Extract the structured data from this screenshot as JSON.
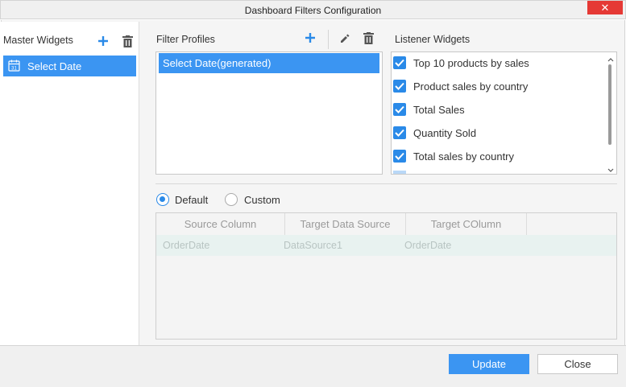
{
  "window": {
    "title": "Dashboard Filters Configuration",
    "close_glyph": "✕"
  },
  "master_widgets": {
    "label": "Master Widgets",
    "items": [
      {
        "label": "Select Date",
        "icon": "calendar-icon"
      }
    ]
  },
  "filter_profiles": {
    "label": "Filter Profiles",
    "items": [
      {
        "label": "Select Date(generated)"
      }
    ]
  },
  "listener_widgets": {
    "label": "Listener Widgets",
    "items": [
      {
        "label": "Top 10 products by sales",
        "checked": true
      },
      {
        "label": "Product sales by country",
        "checked": true
      },
      {
        "label": "Total Sales",
        "checked": true
      },
      {
        "label": "Quantity Sold",
        "checked": true
      },
      {
        "label": "Total sales by country",
        "checked": true
      }
    ]
  },
  "mode": {
    "options": [
      {
        "label": "Default",
        "selected": true
      },
      {
        "label": "Custom",
        "selected": false
      }
    ]
  },
  "mapping_grid": {
    "columns": [
      "Source Column",
      "Target Data Source",
      "Target COlumn"
    ],
    "rows": [
      [
        "OrderDate",
        "DataSource1",
        "OrderDate"
      ]
    ]
  },
  "footer": {
    "update_label": "Update",
    "close_label": "Close"
  },
  "colors": {
    "accent": "#3b95f2",
    "checkbox": "#2a8ae8",
    "close": "#e53935"
  }
}
